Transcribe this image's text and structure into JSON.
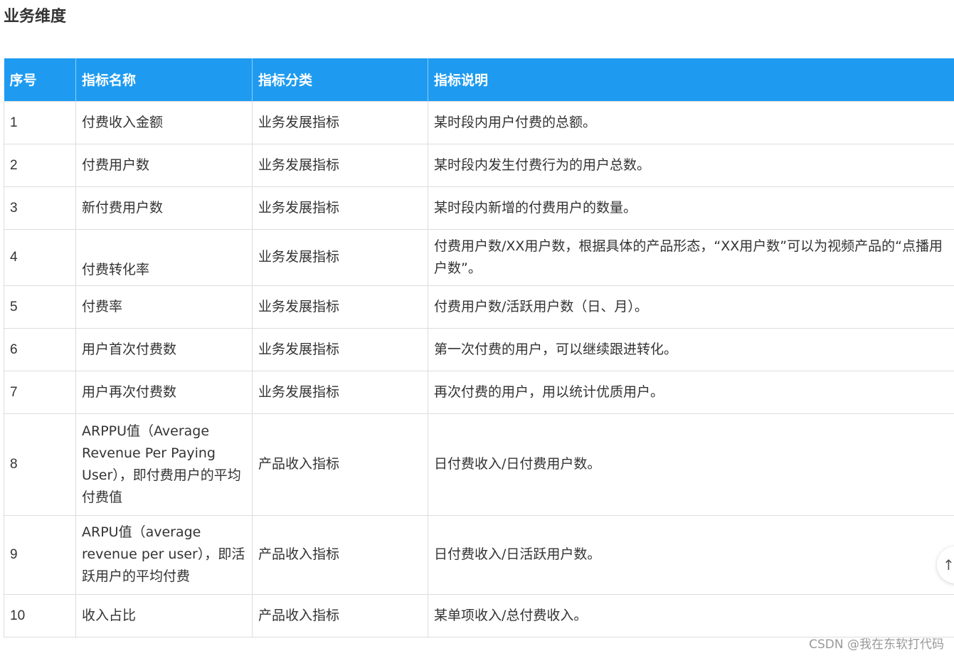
{
  "heading": "业务维度",
  "table": {
    "headers": [
      "序号",
      "指标名称",
      "指标分类",
      "指标说明"
    ],
    "rows": [
      {
        "index": "1",
        "name": "付费收入金额",
        "category": "业务发展指标",
        "description": "某时段内用户付费的总额。"
      },
      {
        "index": "2",
        "name": "付费用户数",
        "category": "业务发展指标",
        "description": "某时段内发生付费行为的用户总数。"
      },
      {
        "index": "3",
        "name": "新付费用户数",
        "category": "业务发展指标",
        "description": "某时段内新增的付费用户的数量。"
      },
      {
        "index": "4",
        "name": "付费转化率",
        "category": "业务发展指标",
        "description": "付费用户数/XX用户数，根据具体的产品形态，“XX用户数”可以为视频产品的“点播用户数”。"
      },
      {
        "index": "5",
        "name": "付费率",
        "category": "业务发展指标",
        "description": "付费用户数/活跃用户数（日、月）。"
      },
      {
        "index": "6",
        "name": "用户首次付费数",
        "category": "业务发展指标",
        "description": "第一次付费的用户，可以继续跟进转化。"
      },
      {
        "index": "7",
        "name": "用户再次付费数",
        "category": "业务发展指标",
        "description": "再次付费的用户，用以统计优质用户。"
      },
      {
        "index": "8",
        "name": "ARPPU值（Average Revenue Per Paying User），即付费用户的平均付费值",
        "category": "产品收入指标",
        "description": "日付费收入/日付费用户数。"
      },
      {
        "index": "9",
        "name": "ARPU值（average revenue per user），即活跃用户的平均付费",
        "category": "产品收入指标",
        "description": "日付费收入/日活跃用户数。"
      },
      {
        "index": "10",
        "name": "收入占比",
        "category": "产品收入指标",
        "description": "某单项收入/总付费收入。"
      }
    ]
  },
  "watermark": "CSDN @我在东软打代码",
  "scroll_top_icon": "arrow-up-icon",
  "colors": {
    "header_background": "#1e9bf0",
    "header_text": "#ffffff",
    "border": "#dddddd"
  }
}
